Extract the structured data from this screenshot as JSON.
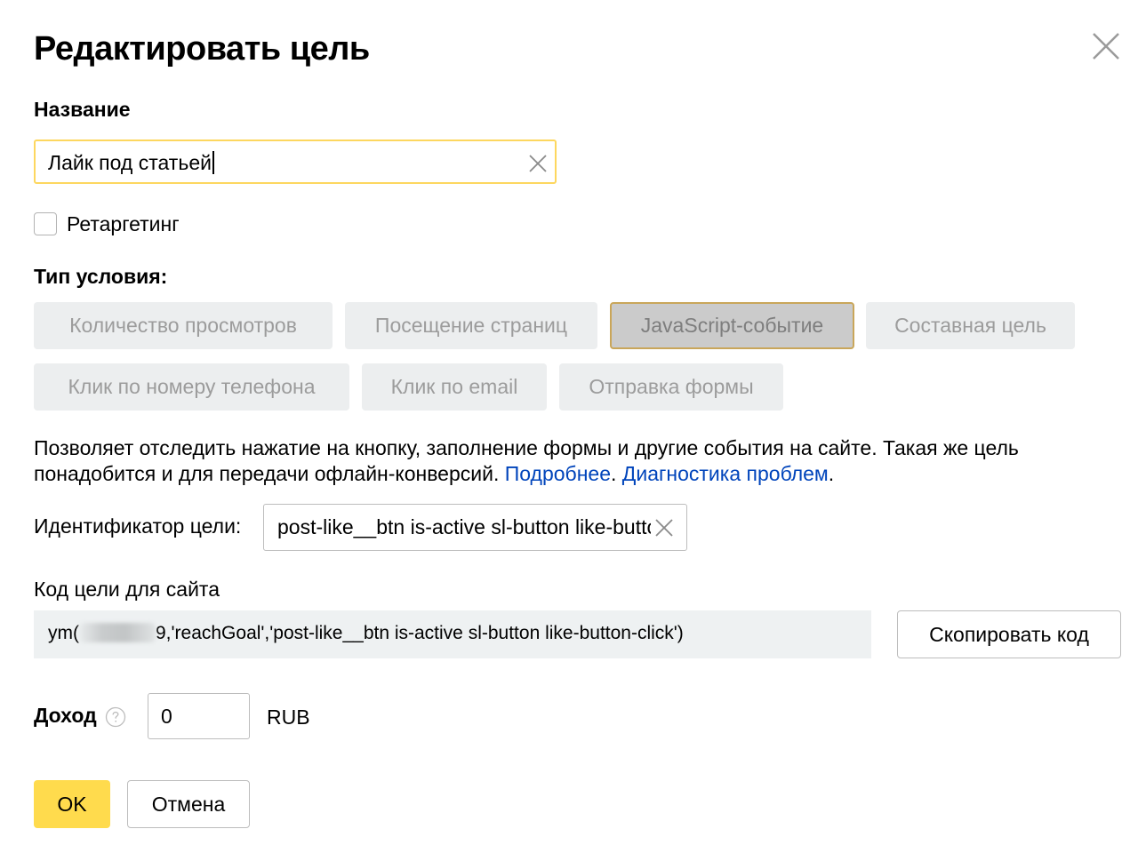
{
  "dialog": {
    "title": "Редактировать цель"
  },
  "name_field": {
    "label": "Название",
    "value": "Лайк под статьей"
  },
  "retargeting": {
    "label": "Ретаргетинг",
    "checked": false
  },
  "condition": {
    "label": "Тип условия:",
    "options": [
      "Количество просмотров",
      "Посещение страниц",
      "JavaScript-событие",
      "Составная цель",
      "Клик по номеру телефона",
      "Клик по email",
      "Отправка формы"
    ],
    "selected": "JavaScript-событие"
  },
  "description": {
    "text": "Позволяет отследить нажатие на кнопку, заполнение формы и другие события на сайте. Такая же цель понадобится и для передачи офлайн-конверсий. ",
    "link_more": "Подробнее",
    "sep": ". ",
    "link_diag": "Диагностика проблем",
    "end": "."
  },
  "goal_id": {
    "label": "Идентификатор цели:",
    "value": "post-like__btn is-active sl-button like-button-click"
  },
  "site_code": {
    "label": "Код цели для сайта",
    "prefix": "ym(",
    "suffix": "9,'reachGoal','post-like__btn is-active sl-button like-button-click')",
    "copy_label": "Скопировать код"
  },
  "income": {
    "label": "Доход",
    "value": "0",
    "currency": "RUB"
  },
  "actions": {
    "ok_label": "OK",
    "cancel_label": "Отмена"
  },
  "colors": {
    "primary_button": "#ffdb4d",
    "focus_border": "#fdd75f",
    "link": "#0044bb",
    "active_segment_border": "#c9a65a"
  }
}
